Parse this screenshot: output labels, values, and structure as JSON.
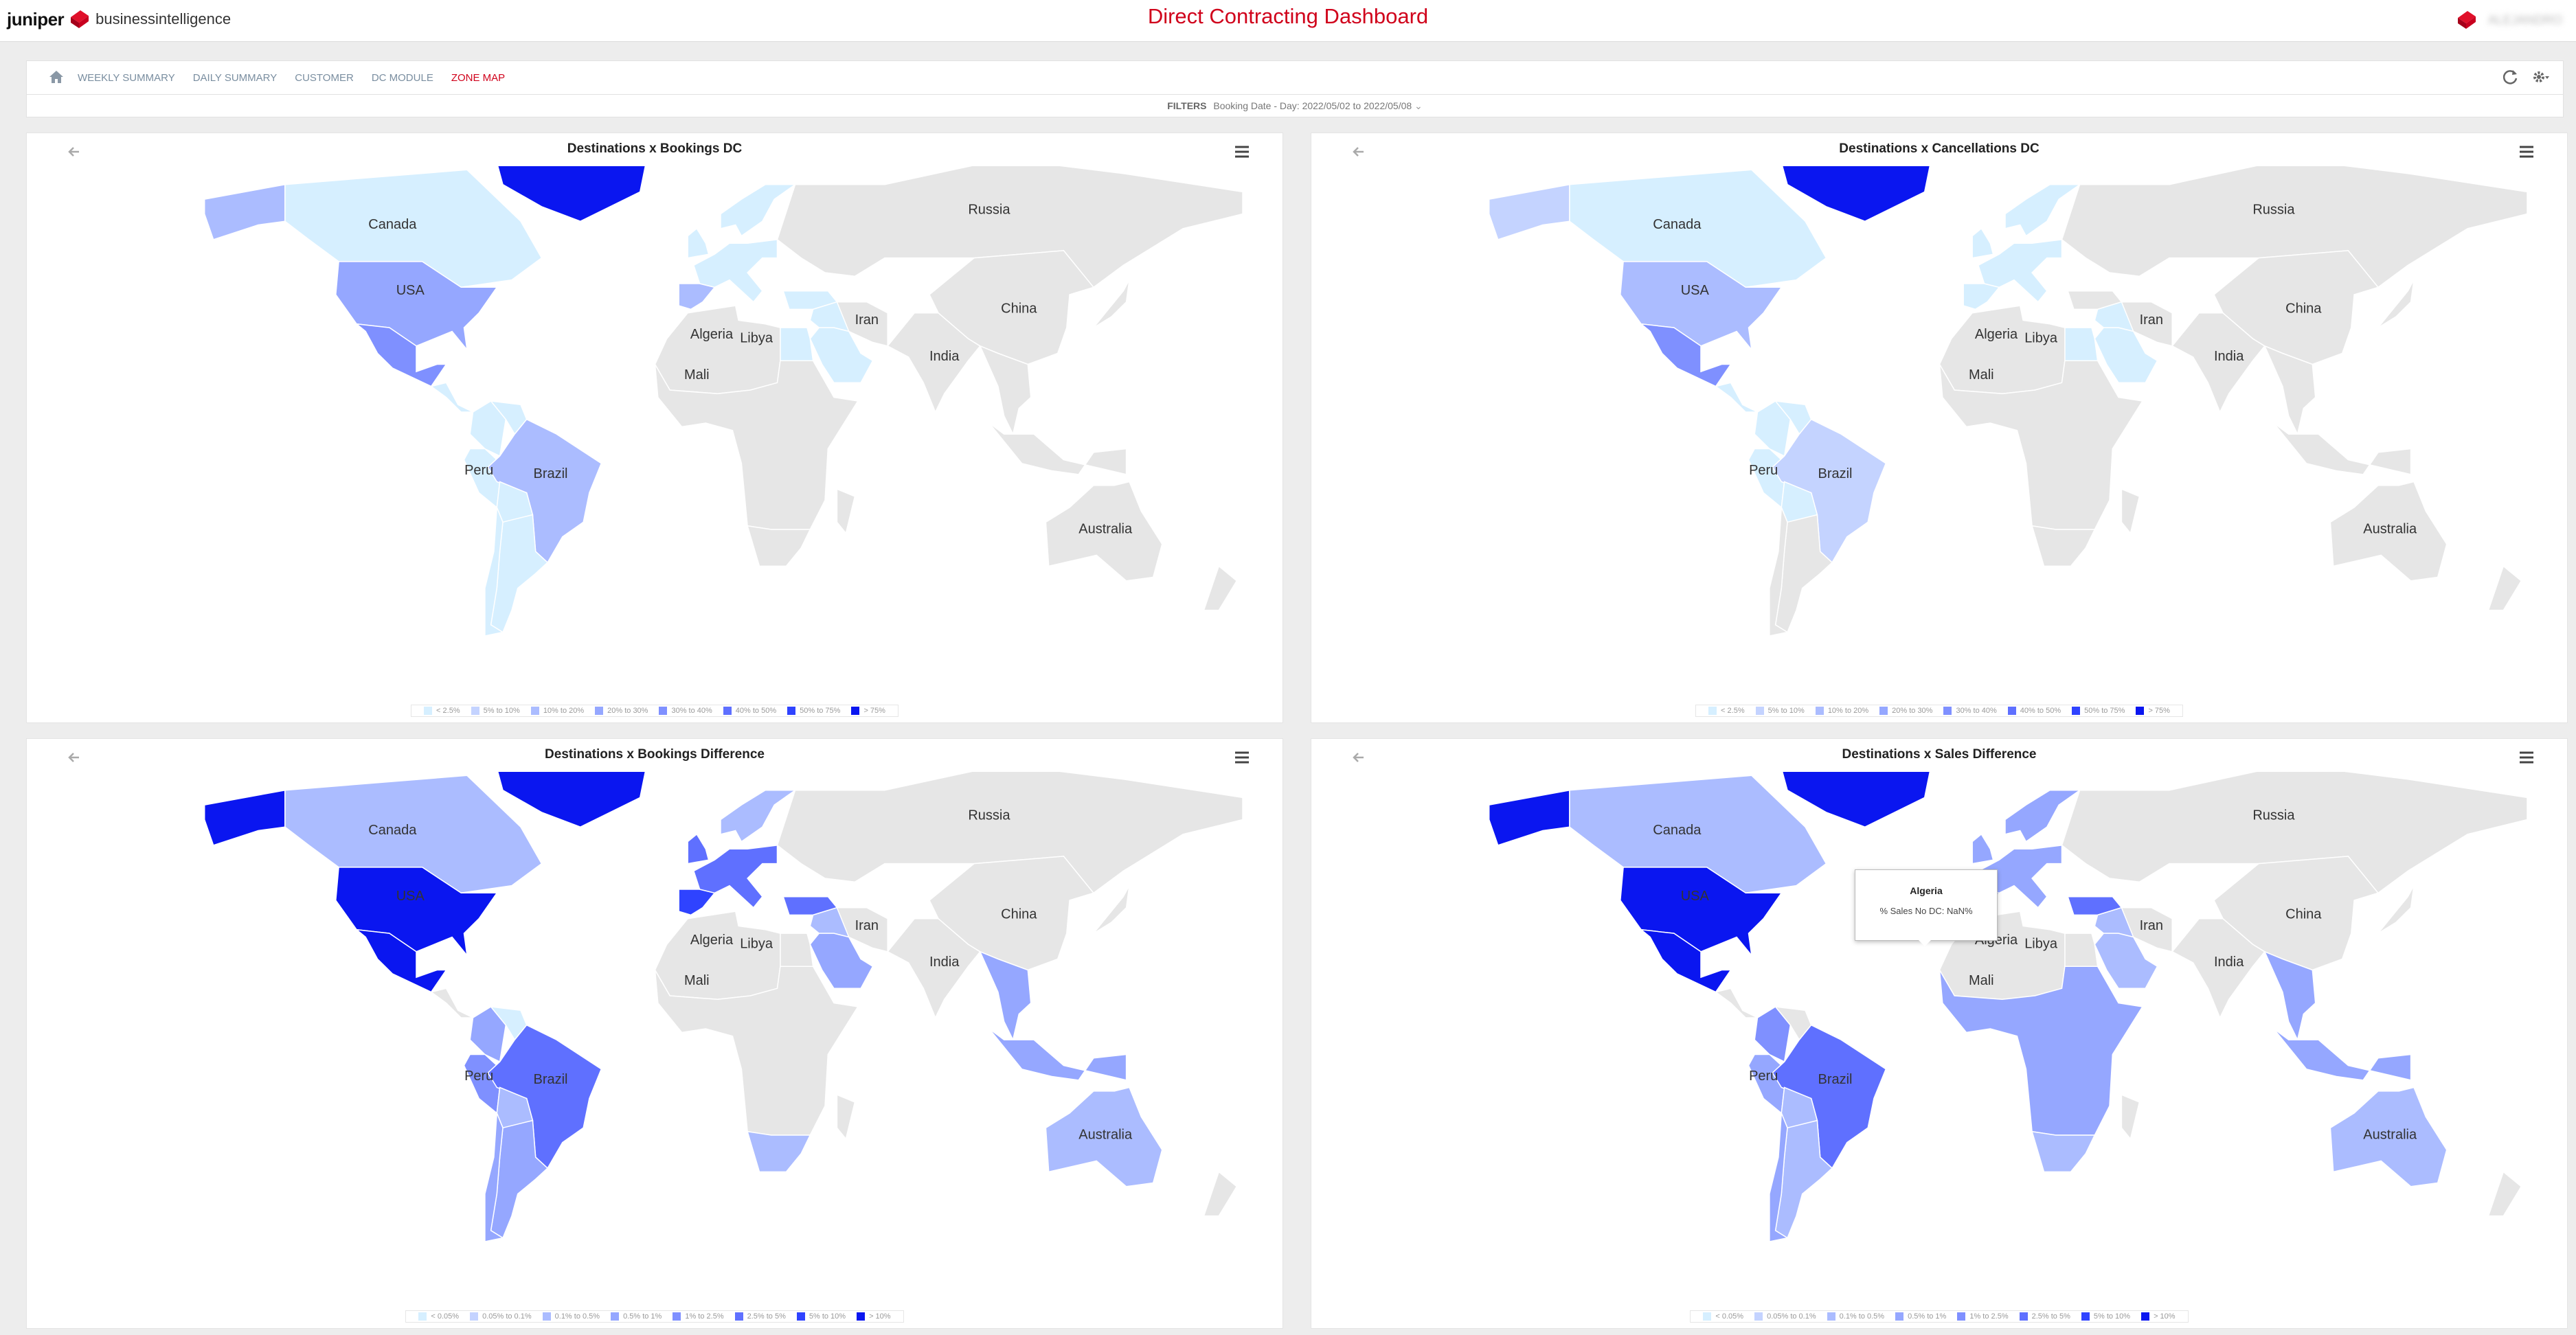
{
  "header": {
    "brand_name": "juniper",
    "brand_suffix": "businessintelligence",
    "title": "Direct Contracting Dashboard",
    "user_name": "ALEJANDRO"
  },
  "nav": {
    "items": [
      {
        "label": "WEEKLY SUMMARY",
        "active": false
      },
      {
        "label": "DAILY SUMMARY",
        "active": false
      },
      {
        "label": "CUSTOMER",
        "active": false
      },
      {
        "label": "DC MODULE",
        "active": false
      },
      {
        "label": "ZONE MAP",
        "active": true
      }
    ]
  },
  "filters": {
    "label": "FILTERS",
    "text": "Booking Date - Day: 2022/05/02 to 2022/05/08"
  },
  "country_labels": [
    {
      "name": "Canada",
      "lon": -105,
      "lat": 58
    },
    {
      "name": "USA",
      "lon": -99,
      "lat": 40
    },
    {
      "name": "Russia",
      "lon": 95,
      "lat": 62
    },
    {
      "name": "China",
      "lon": 105,
      "lat": 35
    },
    {
      "name": "Iran",
      "lon": 54,
      "lat": 32
    },
    {
      "name": "India",
      "lon": 80,
      "lat": 22
    },
    {
      "name": "Algeria",
      "lon": 2,
      "lat": 28
    },
    {
      "name": "Libya",
      "lon": 17,
      "lat": 27
    },
    {
      "name": "Mali",
      "lon": -3,
      "lat": 17
    },
    {
      "name": "Peru",
      "lon": -76,
      "lat": -9
    },
    {
      "name": "Brazil",
      "lon": -52,
      "lat": -10
    },
    {
      "name": "Australia",
      "lon": 134,
      "lat": -25
    }
  ],
  "panels": [
    {
      "id": "bookings-dc",
      "title": "Destinations x Bookings DC",
      "legend": [
        "< 2.5%",
        "5% to 10%",
        "10% to 20%",
        "20% to 30%",
        "30% to 40%",
        "40% to 50%",
        "50% to 75%",
        "> 75%"
      ],
      "fills": {
        "canada": 0,
        "alaska": 2,
        "usa": 3,
        "mexico": 4,
        "central_america": 0,
        "greenland": 7,
        "colombia": 0,
        "venezuela": 0,
        "peru": 0,
        "brazil": 2,
        "bolivia": 0,
        "argentina": 0,
        "chile": 0,
        "western_europe": 0,
        "iberia": 2,
        "scandinavia": 0,
        "russia": 8,
        "north_africa": 8,
        "egypt": 0,
        "saudi": 0,
        "middle_east": 0,
        "turkey": 0,
        "subsaharan": 8,
        "south_africa": 8,
        "madagascar": 8,
        "india": 8,
        "china": 8,
        "seasia": 8,
        "indonesia": 8,
        "japan": 8,
        "australia": 8,
        "nz": 8
      }
    },
    {
      "id": "cancellations-dc",
      "title": "Destinations x Cancellations DC",
      "legend": [
        "< 2.5%",
        "5% to 10%",
        "10% to 20%",
        "20% to 30%",
        "30% to 40%",
        "40% to 50%",
        "50% to 75%",
        "> 75%"
      ],
      "fills": {
        "canada": 0,
        "alaska": 1,
        "usa": 2,
        "mexico": 4,
        "central_america": 0,
        "greenland": 7,
        "colombia": 0,
        "venezuela": 0,
        "peru": 0,
        "brazil": 1,
        "bolivia": 0,
        "argentina": 8,
        "chile": 8,
        "western_europe": 0,
        "iberia": 0,
        "scandinavia": 0,
        "russia": 8,
        "north_africa": 8,
        "egypt": 0,
        "saudi": 0,
        "middle_east": 0,
        "turkey": 8,
        "subsaharan": 8,
        "south_africa": 8,
        "madagascar": 8,
        "india": 8,
        "china": 8,
        "seasia": 8,
        "indonesia": 8,
        "japan": 8,
        "australia": 8,
        "nz": 8
      }
    },
    {
      "id": "bookings-difference",
      "title": "Destinations x Bookings Difference",
      "legend": [
        "< 0.05%",
        "0.05% to 0.1%",
        "0.1% to 0.5%",
        "0.5% to 1%",
        "1% to 2.5%",
        "2.5% to 5%",
        "5% to 10%",
        "> 10%"
      ],
      "fills": {
        "canada": 2,
        "alaska": 7,
        "usa": 7,
        "mexico": 7,
        "central_america": 8,
        "greenland": 7,
        "colombia": 3,
        "venezuela": 0,
        "peru": 4,
        "brazil": 5,
        "bolivia": 2,
        "argentina": 3,
        "chile": 3,
        "western_europe": 5,
        "iberia": 6,
        "scandinavia": 2,
        "russia": 8,
        "north_africa": 8,
        "egypt": 8,
        "saudi": 3,
        "middle_east": 2,
        "turkey": 5,
        "subsaharan": 8,
        "south_africa": 2,
        "madagascar": 8,
        "india": 8,
        "china": 8,
        "seasia": 3,
        "indonesia": 3,
        "japan": 8,
        "australia": 2,
        "nz": 8
      }
    },
    {
      "id": "sales-difference",
      "title": "Destinations x Sales Difference",
      "legend": [
        "< 0.05%",
        "0.05% to 0.1%",
        "0.1% to 0.5%",
        "0.5% to 1%",
        "1% to 2.5%",
        "2.5% to 5%",
        "5% to 10%",
        "> 10%"
      ],
      "fills": {
        "canada": 2,
        "alaska": 7,
        "usa": 7,
        "mexico": 7,
        "central_america": 8,
        "greenland": 7,
        "colombia": 4,
        "venezuela": 8,
        "peru": 3,
        "brazil": 5,
        "bolivia": 2,
        "argentina": 2,
        "chile": 3,
        "western_europe": 3,
        "iberia": 4,
        "scandinavia": 3,
        "russia": 8,
        "north_africa": 8,
        "egypt": 8,
        "saudi": 2,
        "middle_east": 2,
        "turkey": 5,
        "subsaharan": 3,
        "south_africa": 2,
        "madagascar": 8,
        "india": 8,
        "china": 8,
        "seasia": 3,
        "indonesia": 3,
        "japan": 8,
        "australia": 2,
        "nz": 8
      }
    }
  ],
  "palette": [
    "#d6efff",
    "#c4d3ff",
    "#abbcff",
    "#95a7ff",
    "#7f90ff",
    "#5f70ff",
    "#2f43ff",
    "#0a16f0",
    "#e6e6e6"
  ],
  "tooltip": {
    "title": "Algeria",
    "line": "% Sales No DC: NaN%"
  }
}
